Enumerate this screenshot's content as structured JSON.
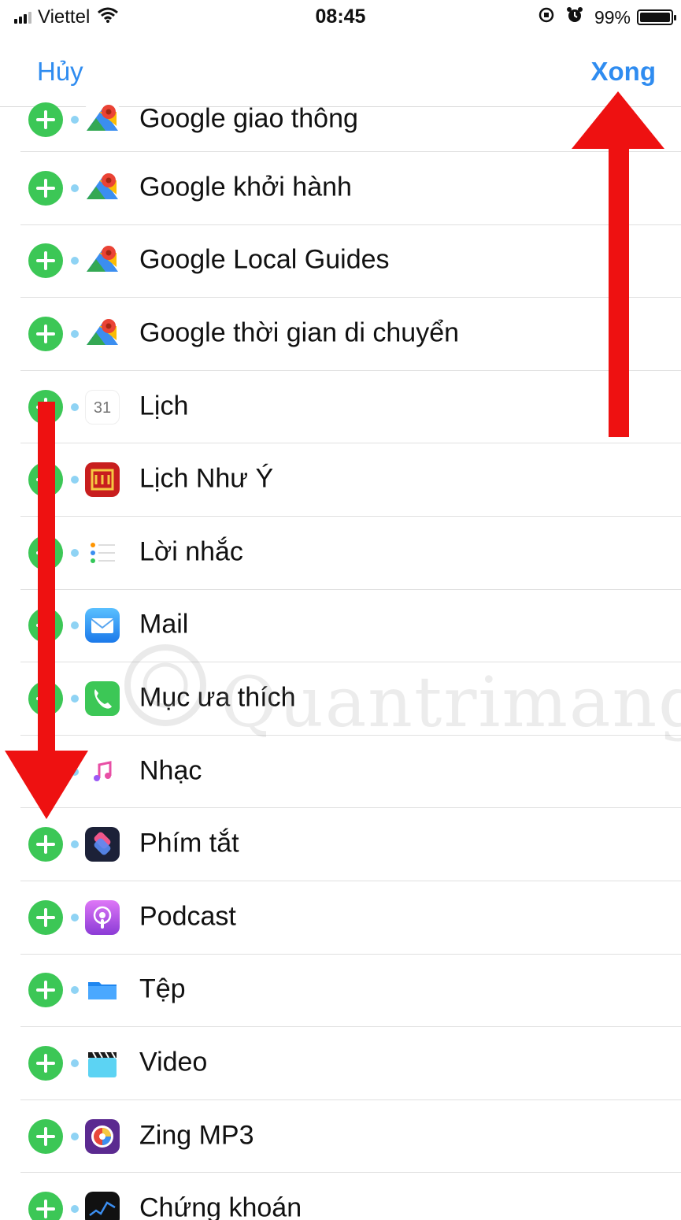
{
  "status_bar": {
    "carrier": "Viettel",
    "time": "08:45",
    "battery_percent": "99%",
    "battery_level": 0.99
  },
  "nav": {
    "cancel_label": "Hủy",
    "done_label": "Xong"
  },
  "list": {
    "items": [
      {
        "label": "Google giao thông",
        "icon": "google-maps-icon"
      },
      {
        "label": "Google khởi hành",
        "icon": "google-maps-icon"
      },
      {
        "label": "Google Local Guides",
        "icon": "google-maps-icon"
      },
      {
        "label": "Google thời gian di chuyển",
        "icon": "google-maps-icon"
      },
      {
        "label": "Lịch",
        "icon": "calendar-icon",
        "icon_text": "31"
      },
      {
        "label": "Lịch Như Ý",
        "icon": "lich-nhu-y-icon"
      },
      {
        "label": "Lời nhắc",
        "icon": "reminders-icon"
      },
      {
        "label": "Mail",
        "icon": "mail-icon"
      },
      {
        "label": "Mục ưa thích",
        "icon": "phone-icon"
      },
      {
        "label": "Nhạc",
        "icon": "music-icon"
      },
      {
        "label": "Phím tắt",
        "icon": "shortcuts-icon"
      },
      {
        "label": "Podcast",
        "icon": "podcast-icon"
      },
      {
        "label": "Tệp",
        "icon": "files-icon"
      },
      {
        "label": "Video",
        "icon": "video-icon"
      },
      {
        "label": "Zing MP3",
        "icon": "zing-mp3-icon"
      },
      {
        "label": "Chứng khoán",
        "icon": "stocks-icon"
      }
    ]
  },
  "colors": {
    "accent": "#2f8cf0",
    "add_button": "#3cc756",
    "arrow": "#ee1111"
  },
  "watermark": {
    "text": "Quantrimang"
  }
}
